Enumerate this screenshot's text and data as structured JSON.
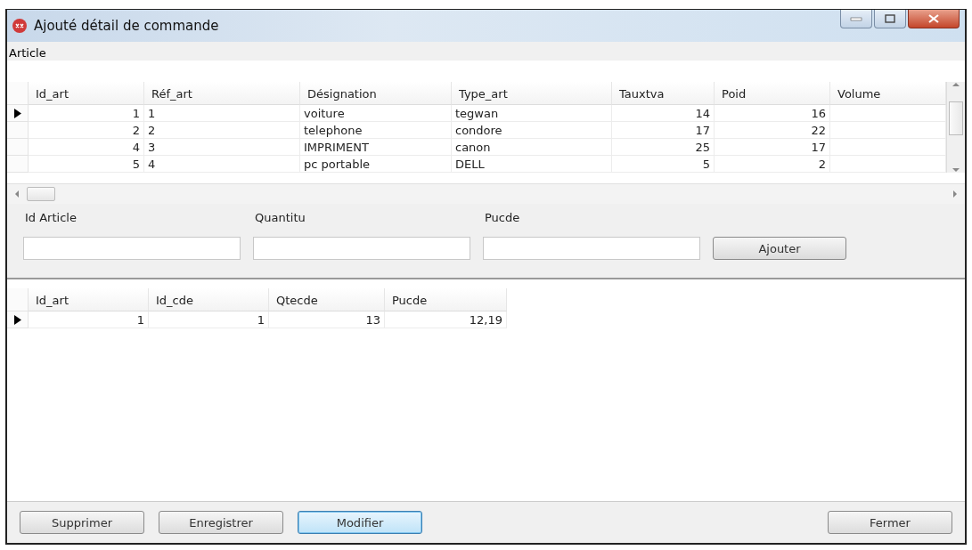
{
  "window": {
    "title": "Ajouté détail de commande"
  },
  "section_label": "Article",
  "articles": {
    "columns": [
      {
        "label": "Id_art",
        "kind": "number"
      },
      {
        "label": "Réf_art",
        "kind": "text"
      },
      {
        "label": "Désignation",
        "kind": "text"
      },
      {
        "label": "Type_art",
        "kind": "text"
      },
      {
        "label": "Tauxtva",
        "kind": "number"
      },
      {
        "label": "Poid",
        "kind": "number"
      },
      {
        "label": "Volume",
        "kind": "number"
      }
    ],
    "rows": [
      {
        "selected": true,
        "cells": [
          "1",
          "1",
          "voiture",
          "tegwan",
          "14",
          "16"
        ]
      },
      {
        "selected": false,
        "cells": [
          "2",
          "2",
          "telephone",
          "condore",
          "17",
          "22"
        ]
      },
      {
        "selected": false,
        "cells": [
          "4",
          "3",
          "IMPRIMENT",
          "canon",
          "25",
          "17"
        ]
      },
      {
        "selected": false,
        "cells": [
          "5",
          "4",
          "pc portable",
          "DELL",
          "5",
          "2"
        ]
      }
    ]
  },
  "form": {
    "fields": [
      {
        "label": "Id Article"
      },
      {
        "label": "Quantitu"
      },
      {
        "label": "Pucde"
      }
    ],
    "button": "Ajouter"
  },
  "details": {
    "columns": [
      {
        "label": "Id_art",
        "kind": "number"
      },
      {
        "label": "Id_cde",
        "kind": "number"
      },
      {
        "label": "Qtecde",
        "kind": "number"
      },
      {
        "label": "Pucde",
        "kind": "number"
      }
    ],
    "rows": [
      {
        "selected": true,
        "cells": [
          "1",
          "1",
          "13",
          "12,19"
        ]
      }
    ]
  },
  "buttons": [
    {
      "label": "Supprimer",
      "default": false
    },
    {
      "label": "Enregistrer",
      "default": false
    },
    {
      "label": "Modifier",
      "default": true
    },
    {
      "label": "Fermer",
      "default": false
    }
  ]
}
